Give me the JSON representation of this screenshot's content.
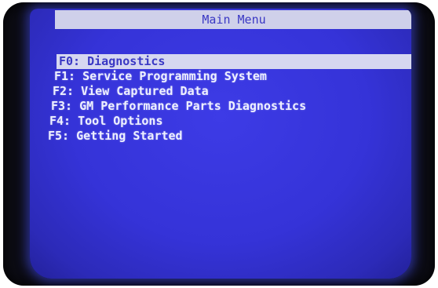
{
  "header": {
    "title": "Main Menu"
  },
  "menu": {
    "items": [
      {
        "label": "F0: Diagnostics",
        "selected": true
      },
      {
        "label": "F1: Service Programming System",
        "selected": false
      },
      {
        "label": "F2: View Captured Data",
        "selected": false
      },
      {
        "label": "F3: GM Performance Parts Diagnostics",
        "selected": false
      },
      {
        "label": "F4: Tool Options",
        "selected": false
      },
      {
        "label": "F5: Getting Started",
        "selected": false
      }
    ]
  },
  "colors": {
    "screen_background": "#3533d8",
    "highlight_bar": "#d6d7f0",
    "text": "#eef0ff"
  }
}
